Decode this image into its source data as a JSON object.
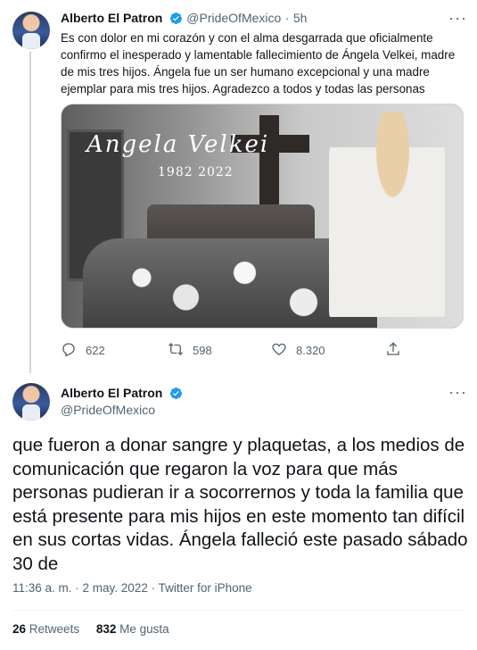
{
  "tweet1": {
    "name": "Alberto El Patron",
    "handle": "@PrideOfMexico",
    "separator": "·",
    "time": "5h",
    "more": "···",
    "text": "Es con dolor en mi corazón y con el alma desgarrada que oficialmente confirmo el inesperado y lamentable fallecimiento de Ángela Velkei, madre de mis tres hijos. Ángela fue un ser humano excepcional y una madre ejemplar para mis tres hijos. Agradezco a todos y todas las personas",
    "media": {
      "overlay_name": "Angela Velkei",
      "overlay_years": "1982 2022"
    },
    "actions": {
      "replies": "622",
      "retweets": "598",
      "likes": "8.320"
    }
  },
  "tweet2": {
    "name": "Alberto El Patron",
    "handle": "@PrideOfMexico",
    "more": "···",
    "text": "que fueron a donar sangre y plaquetas, a los medios de comunicación que regaron la voz para que más personas pudieran ir a socorrernos y toda la familia que está presente para mis hijos en este momento tan difícil en sus cortas vidas. Ángela falleció este pasado sábado 30 de",
    "meta": "11:36 a. m. · 2 may. 2022 · Twitter for iPhone",
    "retweets_count": "26",
    "retweets_label": "Retweets",
    "likes_count": "832",
    "likes_label": "Me gusta"
  },
  "colors": {
    "text": "#0f1419",
    "muted": "#536471",
    "verified": "#1d9bf0",
    "divider": "#eff3f4"
  },
  "icons": [
    "verified-badge-icon",
    "more-icon",
    "reply-icon",
    "retweet-icon",
    "like-icon",
    "share-icon"
  ]
}
